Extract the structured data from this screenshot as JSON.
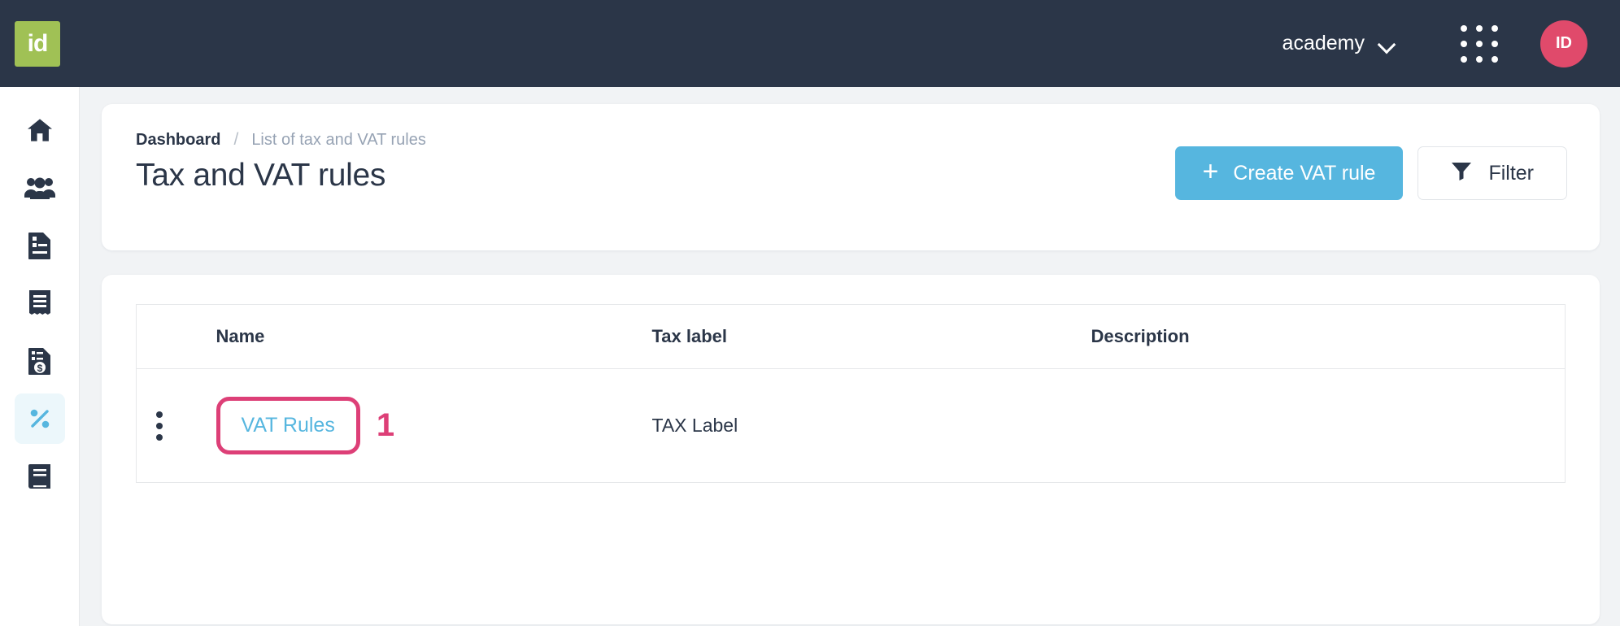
{
  "topbar": {
    "logo_text": "id",
    "org_name": "academy",
    "org_chevron_icon": "chevron-down-icon",
    "apps_icon": "apps-grid-icon",
    "avatar_initials": "ID"
  },
  "sidebar": {
    "items": [
      {
        "icon": "home-icon",
        "name": "sidebar-item-home",
        "active": false
      },
      {
        "icon": "users-icon",
        "name": "sidebar-item-users",
        "active": false
      },
      {
        "icon": "document-icon",
        "name": "sidebar-item-contracts",
        "active": false
      },
      {
        "icon": "receipt-icon",
        "name": "sidebar-item-receipts",
        "active": false
      },
      {
        "icon": "invoice-dollar-icon",
        "name": "sidebar-item-invoices",
        "active": false
      },
      {
        "icon": "percent-icon",
        "name": "sidebar-item-taxes",
        "active": true
      },
      {
        "icon": "book-icon",
        "name": "sidebar-item-ledger",
        "active": false
      }
    ]
  },
  "header": {
    "breadcrumb": {
      "parent": "Dashboard",
      "separator": "/",
      "current": "List of tax and VAT rules"
    },
    "title": "Tax and VAT rules",
    "create_button_label": "Create VAT rule",
    "create_button_icon": "plus-icon",
    "filter_button_label": "Filter",
    "filter_button_icon": "funnel-icon"
  },
  "table": {
    "columns": [
      "Name",
      "Tax label",
      "Description"
    ],
    "rows": [
      {
        "menu_icon": "kebab-menu-icon",
        "name": "VAT Rules",
        "tax_label": "TAX Label",
        "description": ""
      }
    ]
  },
  "annotations": {
    "step_number": "1",
    "highlight_color": "#dd3f77"
  },
  "colors": {
    "topbar_bg": "#2b3648",
    "logo_bg": "#a0c155",
    "avatar_bg": "#e04a6b",
    "accent_blue": "#56b6df",
    "active_nav_bg": "#ecf7fb",
    "page_bg": "#f1f3f5"
  }
}
